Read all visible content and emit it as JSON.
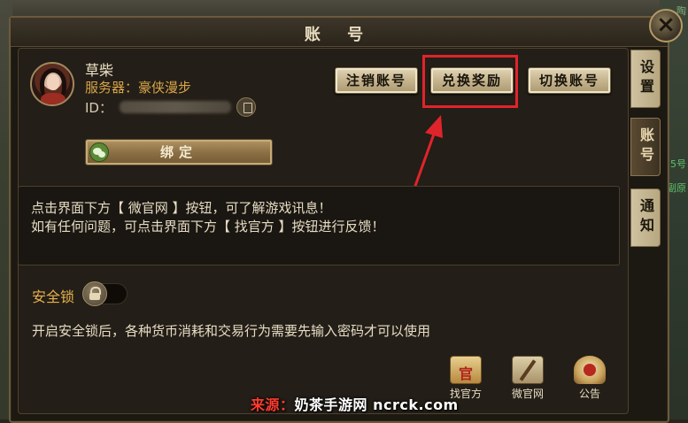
{
  "window": {
    "title": "账 号"
  },
  "tabs": [
    {
      "label": "设置"
    },
    {
      "label": "账号"
    },
    {
      "label": "通知"
    }
  ],
  "profile": {
    "name": "草柴",
    "server_label": "服务器：",
    "server_value": "豪侠漫步",
    "id_label": "ID："
  },
  "buttons": {
    "logout": "注销账号",
    "redeem": "兑换奖励",
    "switch": "切换账号",
    "bind": "绑定"
  },
  "info": {
    "line1": "点击界面下方【 微官网 】按钮，可了解游戏讯息！",
    "line2": "如有任何问题，可点击界面下方【 找官方 】按钮进行反馈！"
  },
  "security": {
    "label": "安全锁",
    "description": "开启安全锁后，各种货币消耗和交易行为需要先输入密码才可以使用",
    "enabled": false
  },
  "bottom_icons": [
    {
      "label": "找官方",
      "icon": "official-seal-icon",
      "glyph": "官"
    },
    {
      "label": "微官网",
      "icon": "scroll-quill-icon"
    },
    {
      "label": "公告",
      "icon": "announcement-icon"
    }
  ],
  "watermark": {
    "source": "来源：",
    "name": "奶茶手游网",
    "site": "ncrck.com"
  },
  "background_labels": [
    "陶",
    "5号",
    "副原"
  ],
  "colors": {
    "accent_gold": "#d9a54a",
    "highlight_red": "#e0242b"
  }
}
